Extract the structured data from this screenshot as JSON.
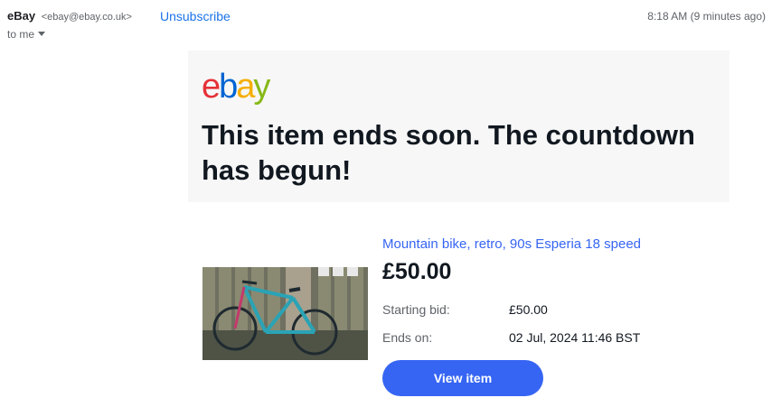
{
  "email": {
    "sender_name": "eBay",
    "sender_email": "<ebay@ebay.co.uk>",
    "unsubscribe_label": "Unsubscribe",
    "timestamp": "8:18 AM (9 minutes ago)",
    "to_label": "to me"
  },
  "hero": {
    "logo": {
      "e": "e",
      "b": "b",
      "a": "a",
      "y": "y"
    },
    "title": "This item ends soon. The countdown has begun!"
  },
  "item": {
    "title": "Mountain bike, retro, 90s Esperia 18 speed",
    "price": "£50.00",
    "details": {
      "starting_bid_label": "Starting bid:",
      "starting_bid_value": "£50.00",
      "ends_on_label": "Ends on:",
      "ends_on_value": "02 Jul, 2024 11:46 BST"
    },
    "button_label": "View item"
  },
  "colors": {
    "link": "#1a73e8",
    "ebay_blue": "#3665f3",
    "logo_red": "#e53238",
    "logo_blue": "#0064d2",
    "logo_yellow": "#f5af02",
    "logo_green": "#86b817"
  }
}
